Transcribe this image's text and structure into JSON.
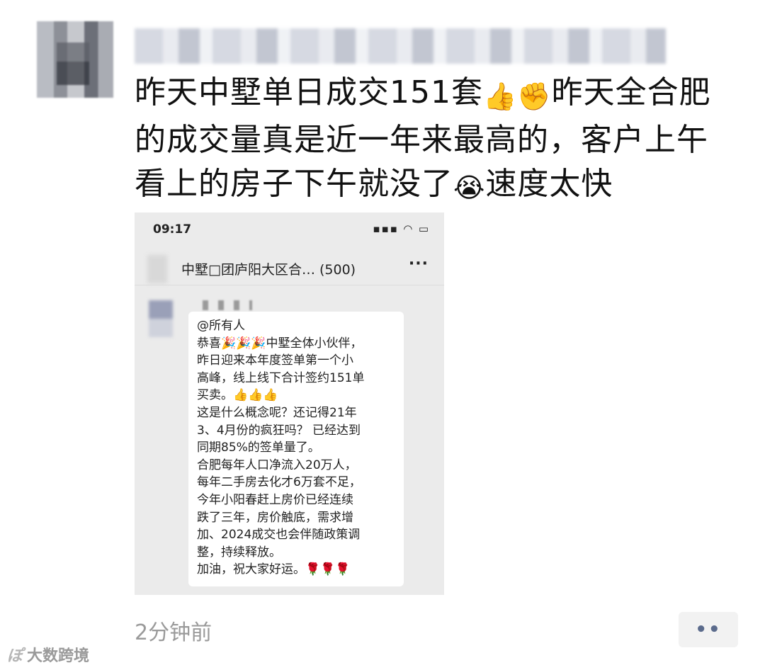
{
  "post": {
    "line1": "昨天中墅单日成交151套",
    "emoji1": "👍",
    "emoji2": "✊",
    "line1b": "昨天全合肥",
    "line2": "的成交量真是近一年来最高的，客户上午",
    "line3": "看上的房子下午就没了",
    "emoji3": "😭",
    "line3b": "速度太快"
  },
  "screenshot": {
    "time": "09:17",
    "status_icons": "▪▪▪ ◠ ▭",
    "group_title": "中墅□团庐阳大区合…  (500)",
    "more": "···",
    "message": "@所有人\n恭喜🎉🎉🎉中墅全体小伙伴，\n昨日迎来本年度签单第一个小\n高峰，线上线下合计签约151单\n买卖。👍👍👍\n这是什么概念呢？还记得21年\n3、4月份的疯狂吗？ 已经达到\n同期85%的签单量了。\n合肥每年人口净流入20万人，\n每年二手房去化才6万套不足，\n今年小阳春赶上房价已经连续\n跌了三年，房价触底，需求增\n加、2024成交也会伴随政策调\n整，持续释放。\n加油，祝大家好运。🌹🌹🌹"
  },
  "footer": {
    "timestamp": "2分钟前",
    "comment_icon": "••",
    "watermark_logo": "ぽ",
    "watermark_text": "大数跨境"
  }
}
